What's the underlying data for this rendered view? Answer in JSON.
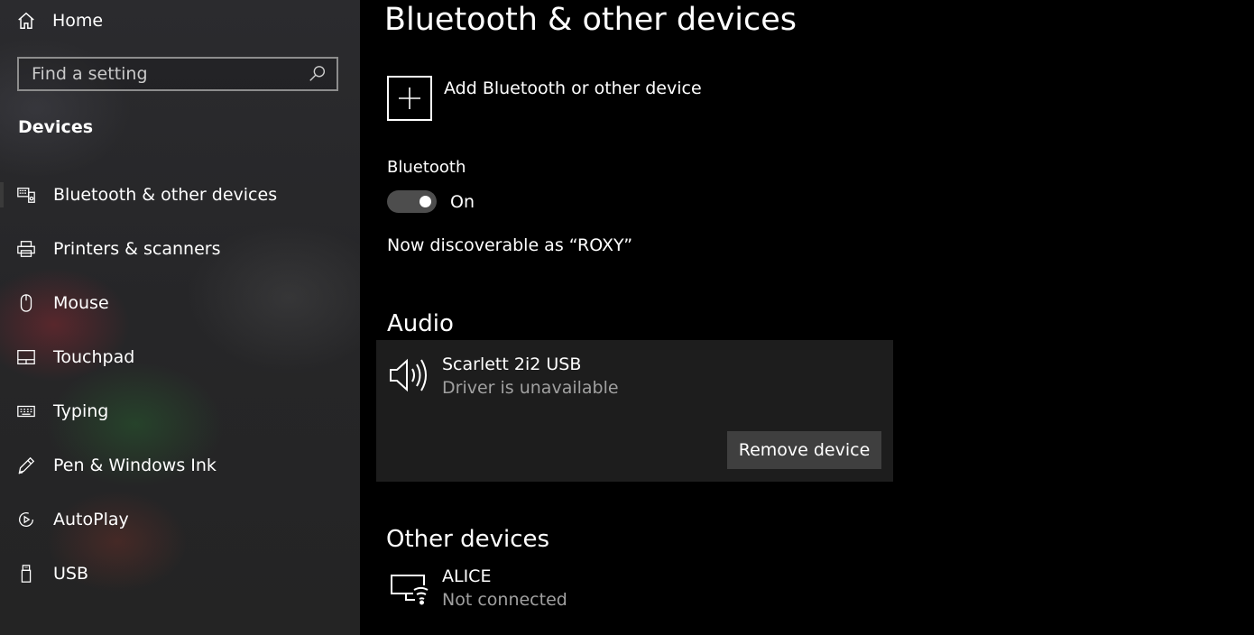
{
  "sidebar": {
    "home_label": "Home",
    "search_placeholder": "Find a setting",
    "section_title": "Devices",
    "items": [
      {
        "label": "Bluetooth & other devices",
        "icon": "bluetooth-devices-icon",
        "active": true
      },
      {
        "label": "Printers & scanners",
        "icon": "printer-icon"
      },
      {
        "label": "Mouse",
        "icon": "mouse-icon"
      },
      {
        "label": "Touchpad",
        "icon": "touchpad-icon"
      },
      {
        "label": "Typing",
        "icon": "keyboard-icon"
      },
      {
        "label": "Pen & Windows Ink",
        "icon": "pen-icon"
      },
      {
        "label": "AutoPlay",
        "icon": "autoplay-icon"
      },
      {
        "label": "USB",
        "icon": "usb-icon"
      }
    ]
  },
  "main": {
    "title": "Bluetooth & other devices",
    "add_device_label": "Add Bluetooth or other device",
    "bluetooth_label": "Bluetooth",
    "bluetooth_state": "On",
    "discoverable_text": "Now discoverable as “ROXY”",
    "audio_heading": "Audio",
    "audio_device": {
      "name": "Scarlett 2i2 USB",
      "status": "Driver is unavailable",
      "remove_label": "Remove device",
      "icon": "speaker-icon"
    },
    "other_heading": "Other devices",
    "other_device": {
      "name": "ALICE",
      "status": "Not connected",
      "icon": "wireless-display-icon"
    }
  },
  "colors": {
    "background": "#000000",
    "card": "#1d1d1d",
    "button": "#3f3f3f",
    "toggle": "#4d4d4d",
    "secondary_text": "#a0a0a0"
  }
}
